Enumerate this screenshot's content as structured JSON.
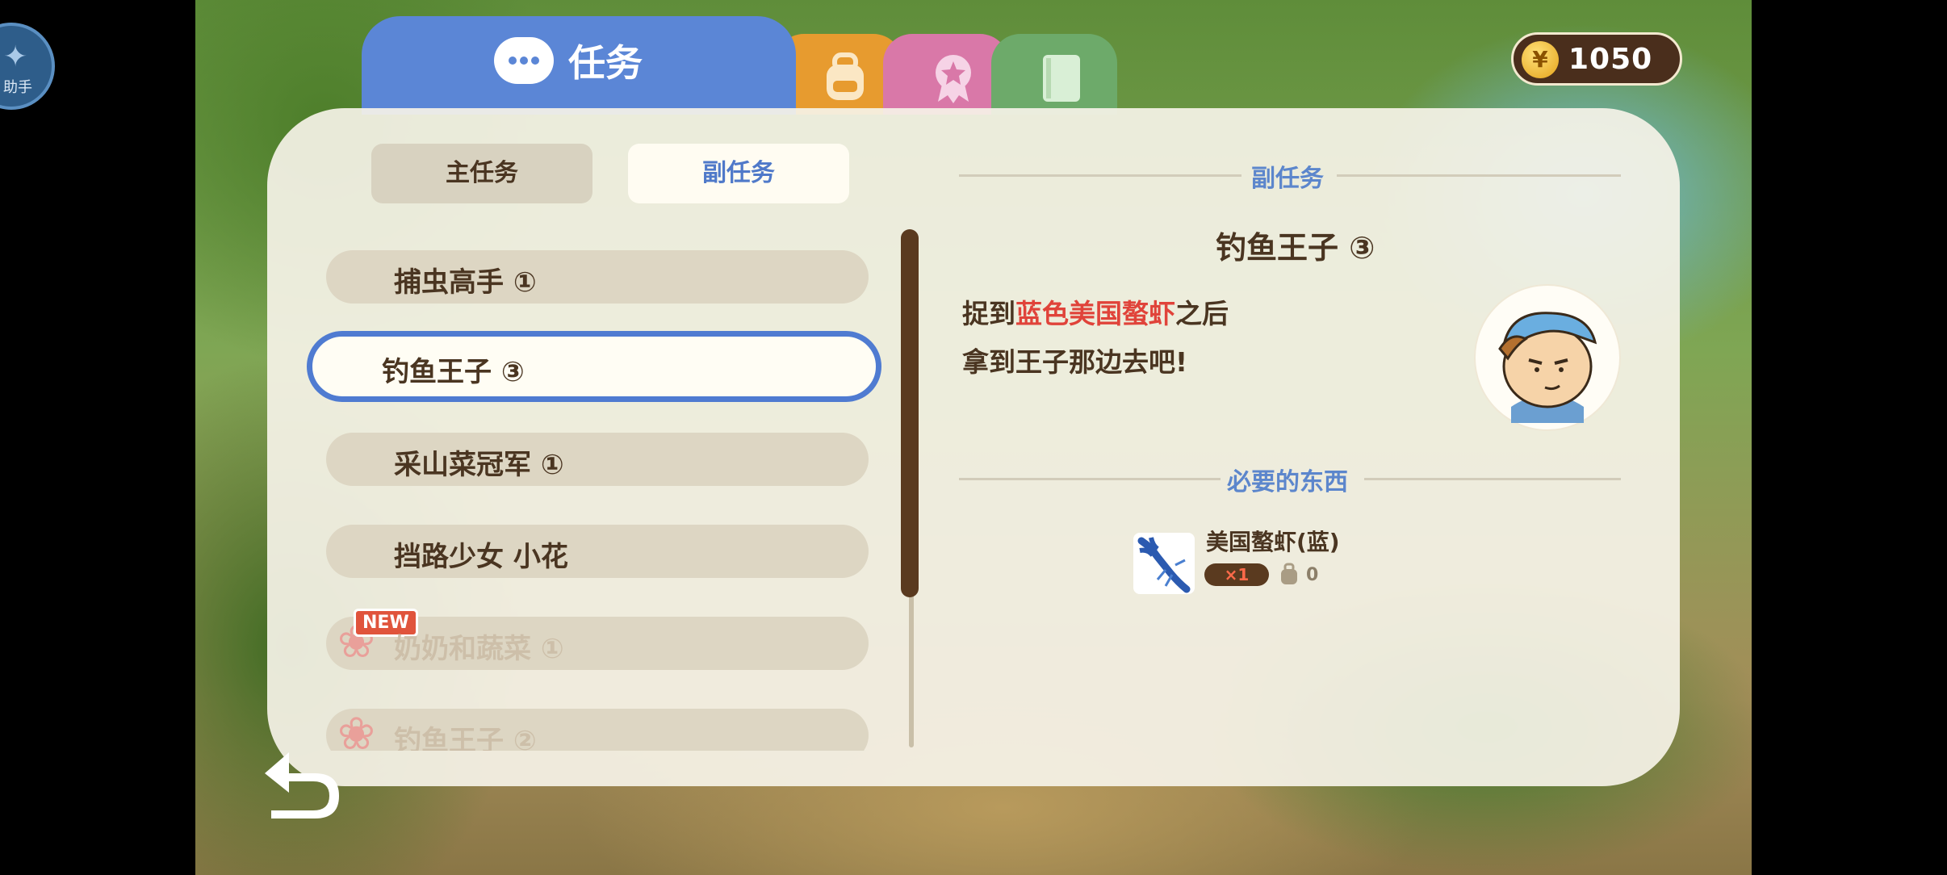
{
  "assistant_label": "助手",
  "coins": "1050",
  "coin_symbol": "¥",
  "tabs": {
    "tasks_label": "任务"
  },
  "subtabs": {
    "main": "主任务",
    "side": "副任务"
  },
  "quests": [
    {
      "label": "捕虫高手 ①",
      "state": "normal"
    },
    {
      "label": "钓鱼王子 ③",
      "state": "selected"
    },
    {
      "label": "采山菜冠军 ①",
      "state": "normal"
    },
    {
      "label": "挡路少女 小花",
      "state": "normal"
    },
    {
      "label": "奶奶和蔬菜 ①",
      "state": "locked",
      "badge": "NEW"
    },
    {
      "label": "钓鱼王子 ②",
      "state": "locked"
    }
  ],
  "detail": {
    "section_title": "副任务",
    "quest_name": "钓鱼王子 ③",
    "desc_line1_pre": "捉到",
    "desc_line1_highlight": "蓝色美国螯虾",
    "desc_line1_post": "之后",
    "desc_line2": "拿到王子那边去吧!",
    "required_title": "必要的东西",
    "required_item": {
      "name": "美国螯虾(蓝)",
      "need": "×1",
      "have": "0"
    }
  },
  "colors": {
    "tasks_tab": "#5b86d6",
    "bag_tab": "#e79b2f",
    "medal_tab": "#d978a8",
    "book_tab": "#6daa6a",
    "highlight": "#e0433a",
    "text_brown": "#4a3521"
  },
  "icons": [
    "chat-bubble-icon",
    "backpack-icon",
    "medal-icon",
    "book-icon",
    "coin-icon",
    "back-arrow-icon",
    "crayfish-icon",
    "bag-small-icon",
    "flower-icon",
    "boy-portrait-icon"
  ]
}
